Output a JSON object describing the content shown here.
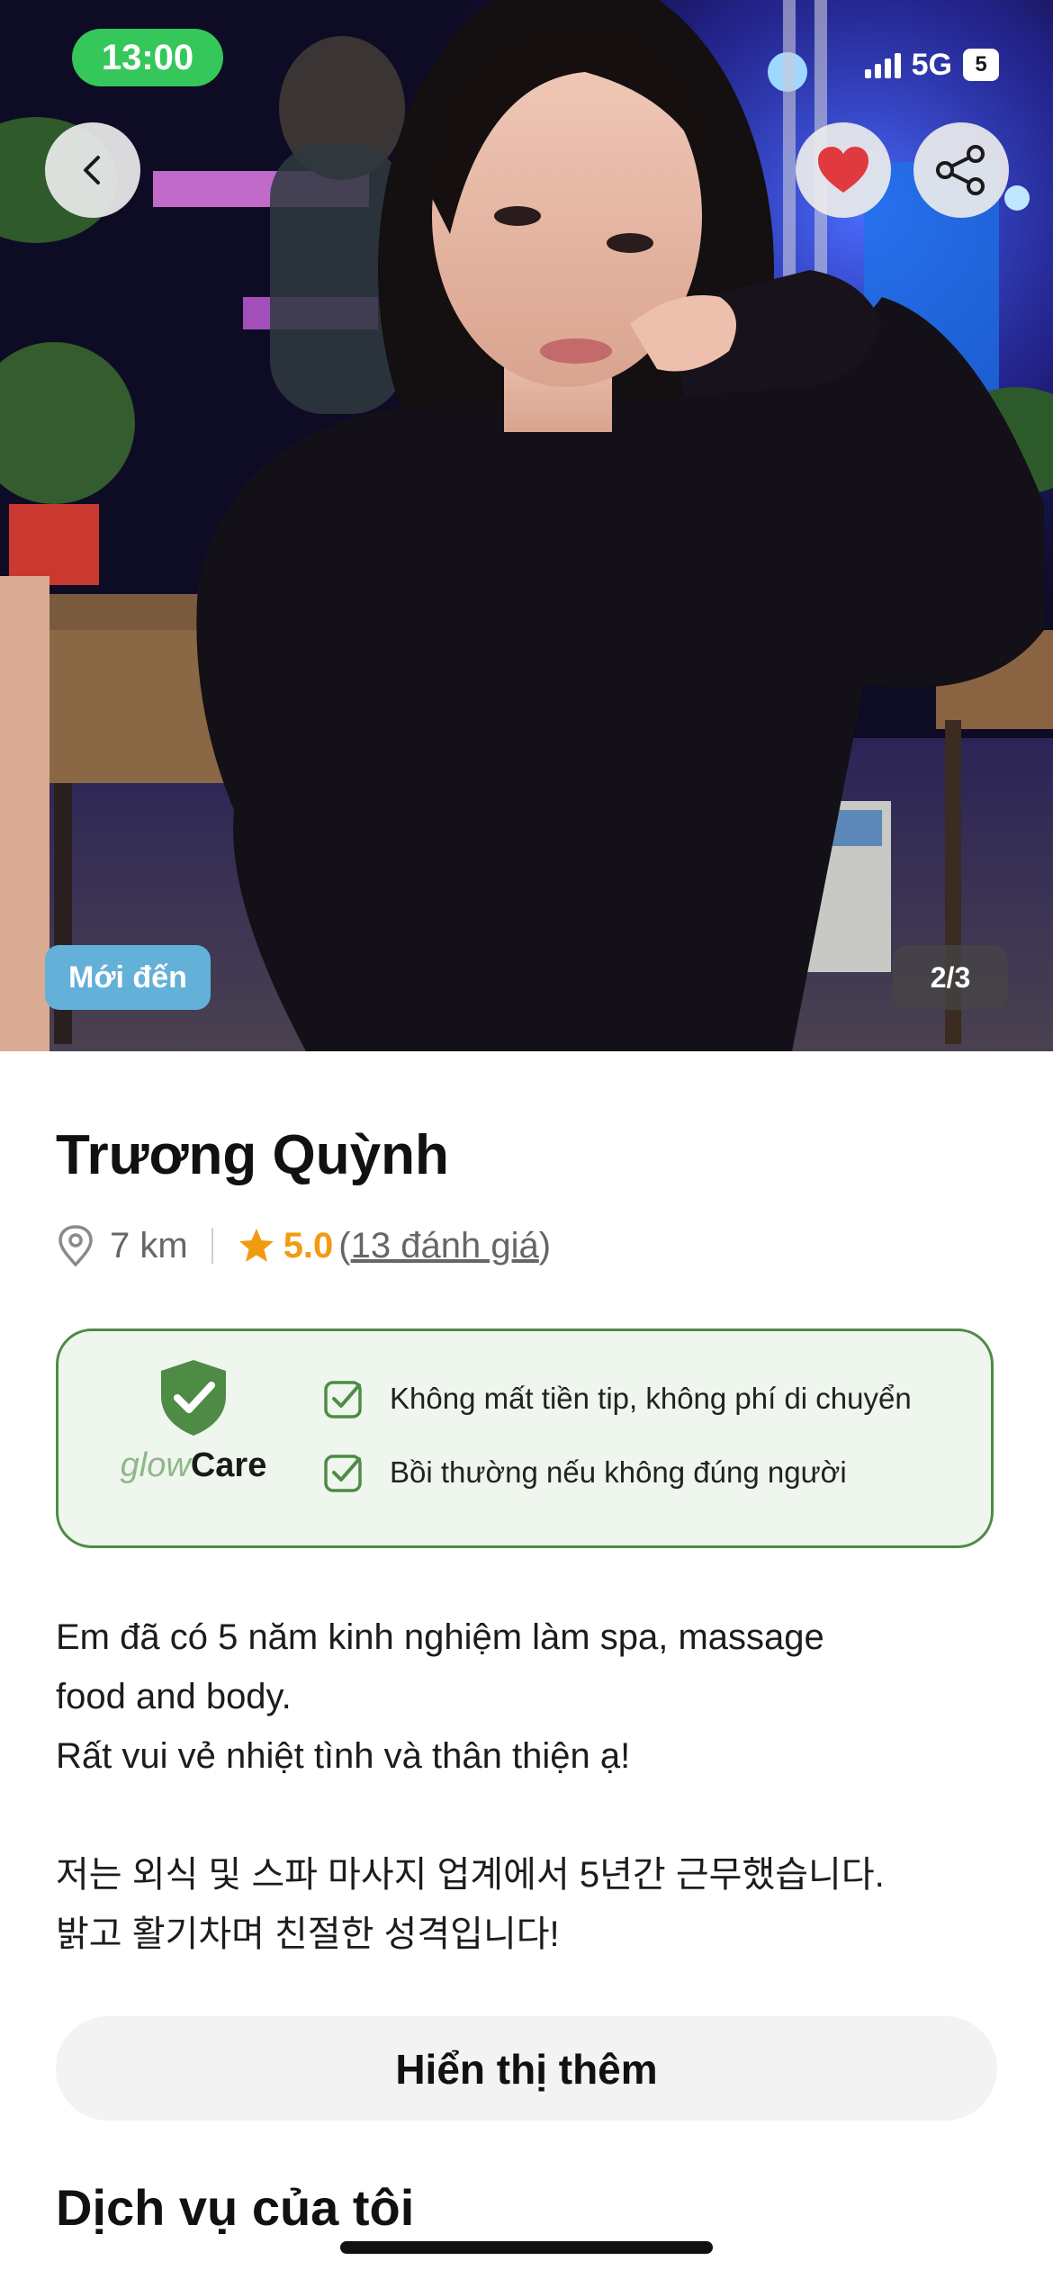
{
  "status_bar": {
    "time": "13:00",
    "network": "5G",
    "battery": "5"
  },
  "photo": {
    "badge": "Mới đến",
    "counter": "2/3"
  },
  "icons": {
    "back": "chevron-left-icon",
    "favorite": "heart-icon",
    "share": "share-icon",
    "location": "location-pin-icon",
    "star": "star-icon",
    "shield": "shield-check-icon",
    "checkbox": "checkbox-icon"
  },
  "profile": {
    "name": "Trương Quỳnh",
    "distance": "7 km",
    "rating": "5.0",
    "reviews_open": "(",
    "reviews_link": "13 đánh giá",
    "reviews_close": ")"
  },
  "glowcare": {
    "logo_glow": "glow",
    "logo_care": "Care",
    "item_1": "Không mất tiền tip, không phí di chuyển",
    "item_2": "Bồi thường nếu không đúng người"
  },
  "bio": {
    "line_1": "Em đã có 5 năm kinh nghiệm làm spa, massage",
    "line_2": "food and body.",
    "line_3": "Rất vui vẻ nhiệt tình và thân thiện ạ!",
    "line_4": "저는 외식 및 스파 마사지 업계에서 5년간 근무했습니다.",
    "line_5": "밝고 활기차며 친절한 성격입니다!"
  },
  "buttons": {
    "show_more": "Hiển thị thêm"
  },
  "sections": {
    "services_title": "Dịch vụ của tôi"
  },
  "colors": {
    "accent_green": "#35c759",
    "care_border": "#4e8b45",
    "care_bg": "#eff6ed",
    "rating_orange": "#f29b12",
    "heart_red": "#e0393e",
    "new_badge_blue": "#63b0d9"
  }
}
